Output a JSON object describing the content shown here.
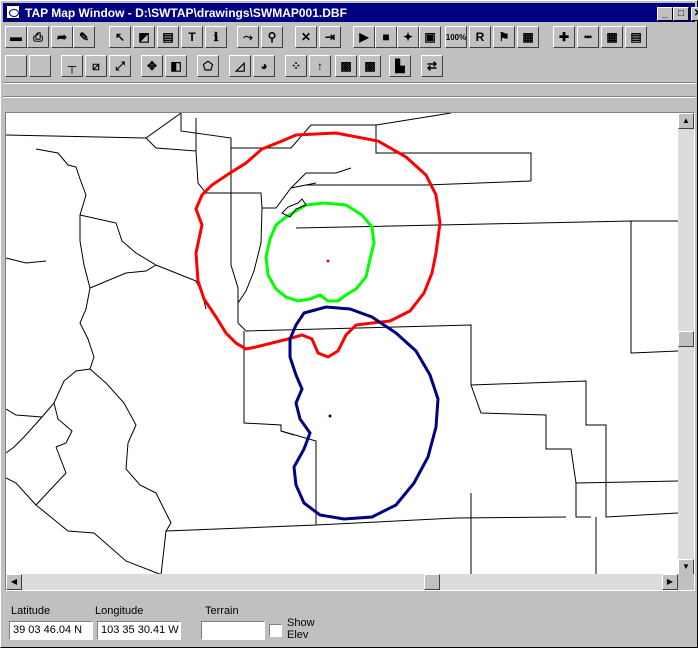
{
  "window": {
    "title": "TAP Map Window - D:\\SWTAP\\drawings\\SWMAP001.DBF",
    "controls": {
      "minimize": "_",
      "maximize": "□",
      "close": "✕"
    }
  },
  "toolbar1": {
    "buttons": [
      {
        "name": "save-icon",
        "glyph": "▬"
      },
      {
        "name": "print-icon",
        "glyph": "⎙"
      },
      {
        "name": "export-icon",
        "glyph": "➦"
      },
      {
        "name": "edit-icon",
        "glyph": "✎"
      },
      {
        "name": "pointer-icon",
        "glyph": "↖"
      },
      {
        "name": "paint-icon",
        "glyph": "◩"
      },
      {
        "name": "layers-icon",
        "glyph": "▤"
      },
      {
        "name": "text-icon",
        "glyph": "T"
      },
      {
        "name": "info-icon",
        "glyph": "ℹ"
      },
      {
        "name": "route-icon",
        "glyph": "⤳"
      },
      {
        "name": "probe-icon",
        "glyph": "⚲"
      },
      {
        "name": "delete-icon",
        "glyph": "✕"
      },
      {
        "name": "exit-icon",
        "glyph": "⇥"
      },
      {
        "name": "play-icon",
        "glyph": "▶"
      },
      {
        "name": "stop-icon",
        "glyph": "■"
      },
      {
        "name": "marker-icon",
        "glyph": "✦"
      },
      {
        "name": "record-icon",
        "glyph": "▣"
      },
      {
        "name": "zoom-100-icon",
        "glyph": "100%"
      },
      {
        "name": "label-r-icon",
        "glyph": "R"
      },
      {
        "name": "flag-icon",
        "glyph": "⚑"
      },
      {
        "name": "map-icon",
        "glyph": "▦"
      },
      {
        "name": "crosshair-icon",
        "glyph": "✚"
      },
      {
        "name": "ruler-icon",
        "glyph": "┅"
      },
      {
        "name": "grid-icon",
        "glyph": "▦"
      },
      {
        "name": "notes-icon",
        "glyph": "▤"
      }
    ]
  },
  "toolbar2": {
    "buttons": [
      {
        "name": "blank-icon",
        "glyph": ""
      },
      {
        "name": "blank-icon",
        "glyph": ""
      },
      {
        "name": "line-icon",
        "glyph": "┬"
      },
      {
        "name": "select-area-icon",
        "glyph": "⧄"
      },
      {
        "name": "resize-icon",
        "glyph": "⤢"
      },
      {
        "name": "move-icon",
        "glyph": "✥"
      },
      {
        "name": "overlay-icon",
        "glyph": "◧"
      },
      {
        "name": "polygon-icon",
        "glyph": "⬠"
      },
      {
        "name": "profile-icon",
        "glyph": "◿"
      },
      {
        "name": "globe-icon",
        "glyph": "◕"
      },
      {
        "name": "scatter-icon",
        "glyph": "⁘"
      },
      {
        "name": "transmitter-icon",
        "glyph": "↑"
      },
      {
        "name": "raster-icon",
        "glyph": "▩"
      },
      {
        "name": "raster-color-icon",
        "glyph": "▩"
      },
      {
        "name": "histogram-icon",
        "glyph": "▙"
      },
      {
        "name": "swap-icon",
        "glyph": "⇄"
      }
    ]
  },
  "map": {
    "colors": {
      "border": "#000000",
      "outer_contour": "#ff0000",
      "inner_contour": "#00ff00",
      "second_site": "#000080"
    }
  },
  "status": {
    "latitude_label": "Latitude",
    "latitude_value": "39 03 46.04 N",
    "longitude_label": "Longitude",
    "longitude_value": "103 35 30.41 W",
    "terrain_label": "Terrain",
    "terrain_value": "",
    "show_elev_label_1": "Show",
    "show_elev_label_2": "Elev",
    "show_elev_checked": false
  }
}
